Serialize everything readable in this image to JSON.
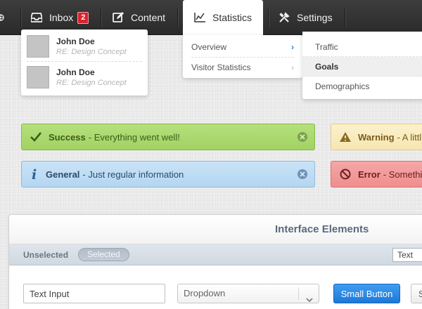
{
  "nav": {
    "inbox_label": "Inbox",
    "inbox_badge": "2",
    "content_label": "Content",
    "statistics_label": "Statistics",
    "settings_label": "Settings"
  },
  "inbox_dropdown": {
    "messages": [
      {
        "name": "John Doe",
        "subject": "RE: Design Concept"
      },
      {
        "name": "John Doe",
        "subject": "RE: Design Concept"
      }
    ]
  },
  "statistics_dropdown": {
    "items": [
      {
        "label": "Overview",
        "active": true
      },
      {
        "label": "Visitor Statistics",
        "active": false
      }
    ],
    "submenu": [
      {
        "label": "Traffic",
        "selected": false
      },
      {
        "label": "Goals",
        "selected": true
      },
      {
        "label": "Demographics",
        "selected": false
      }
    ]
  },
  "alerts": {
    "success": {
      "title": "Success",
      "text": "- Everything went well!"
    },
    "general": {
      "title": "General",
      "text": "- Just regular information"
    },
    "warning": {
      "title": "Warning",
      "text": "- A littl"
    },
    "error": {
      "title": "Error",
      "text": "- Somethin"
    }
  },
  "panel": {
    "title": "Interface Elements",
    "tab_unselected": "Unselected",
    "tab_selected": "Selected",
    "bar_input_value": "Text",
    "text_input_value": "Text Input",
    "dropdown_label": "Dropdown",
    "small_button_label": "Small Button",
    "gray_button_label": "S"
  },
  "colors": {
    "navbar": "#333333",
    "badge": "#d9232d",
    "success": "#a1d262",
    "info": "#b4d6f1",
    "warning": "#f6e6b2",
    "error": "#ef8e8e",
    "primary_button": "#1d78d8"
  },
  "icons": {
    "logo": "gear-logo-icon",
    "inbox": "inbox-tray-icon",
    "content": "edit-icon",
    "statistics": "line-chart-icon",
    "settings": "tools-icon"
  }
}
